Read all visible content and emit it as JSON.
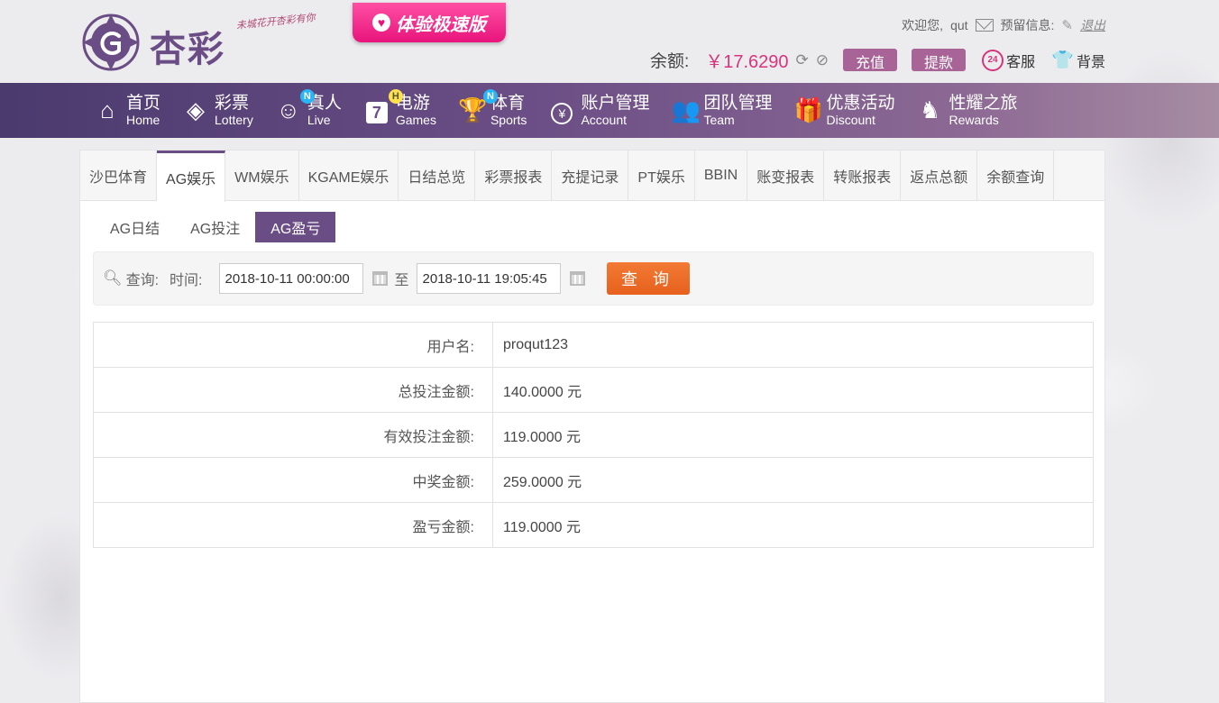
{
  "header": {
    "logo_text": "杏彩",
    "slogan": "未城花开杏彩有你",
    "promo_label": "体验极速版",
    "welcome": "欢迎您,",
    "username": "qut",
    "message_label": "预留信息:",
    "logout_label": "退出",
    "balance_label": "余额:",
    "balance_value": "￥17.6290",
    "recharge_label": "充值",
    "withdraw_label": "提款",
    "service_label": "客服",
    "background_label": "背景",
    "accent_color": "#d6357d"
  },
  "nav": {
    "items": [
      {
        "zh": "首页",
        "en": "Home",
        "icon": "home-icon"
      },
      {
        "zh": "彩票",
        "en": "Lottery",
        "icon": "lottery-ticket-icon"
      },
      {
        "zh": "真人",
        "en": "Live",
        "icon": "dealer-icon",
        "badge": "N"
      },
      {
        "zh": "电游",
        "en": "Games",
        "icon": "slot-seven-icon",
        "badge": "H"
      },
      {
        "zh": "体育",
        "en": "Sports",
        "icon": "trophy-icon",
        "badge": "N"
      },
      {
        "zh": "账户管理",
        "en": "Account",
        "icon": "yen-coin-icon"
      },
      {
        "zh": "团队管理",
        "en": "Team",
        "icon": "team-icon"
      },
      {
        "zh": "优惠活动",
        "en": "Discount",
        "icon": "gift-icon"
      },
      {
        "zh": "性耀之旅",
        "en": "Rewards",
        "icon": "rewards-icon"
      }
    ],
    "bar_color": "#6c4f86"
  },
  "tabs": [
    "沙巴体育",
    "AG娱乐",
    "WM娱乐",
    "KGAME娱乐",
    "日结总览",
    "彩票报表",
    "充提记录",
    "PT娱乐",
    "BBIN",
    "账变报表",
    "转账报表",
    "返点总额",
    "余额查询"
  ],
  "active_tab": "AG娱乐",
  "subtabs": [
    "AG日结",
    "AG投注",
    "AG盈亏"
  ],
  "active_subtab": "AG盈亏",
  "query": {
    "query_label": "查询:",
    "time_label": "时间:",
    "start": "2018-10-11 00:00:00",
    "to_label": "至",
    "end": "2018-10-11 19:05:45",
    "button_label": "查 询"
  },
  "results": [
    {
      "label": "用户名:",
      "value": "proqut123"
    },
    {
      "label": "总投注金额:",
      "value": "140.0000 元"
    },
    {
      "label": "有效投注金额:",
      "value": "119.0000 元"
    },
    {
      "label": "中奖金额:",
      "value": "259.0000 元"
    },
    {
      "label": "盈亏金额:",
      "value": "119.0000 元"
    }
  ]
}
